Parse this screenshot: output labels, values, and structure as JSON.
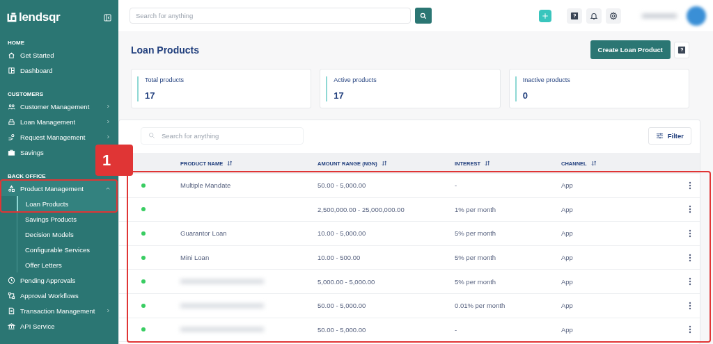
{
  "sidebar": {
    "logo": "lendsqr",
    "sections": [
      {
        "title": "HOME",
        "items": [
          {
            "label": "Get Started",
            "expandable": false,
            "expanded": false
          },
          {
            "label": "Dashboard",
            "expandable": false,
            "expanded": false
          }
        ]
      },
      {
        "title": "CUSTOMERS",
        "items": [
          {
            "label": "Customer Management",
            "expandable": true,
            "expanded": false
          },
          {
            "label": "Loan Management",
            "expandable": true,
            "expanded": false
          },
          {
            "label": "Request Management",
            "expandable": true,
            "expanded": false
          },
          {
            "label": "Savings",
            "expandable": false,
            "expanded": false
          }
        ]
      },
      {
        "title": "BACK OFFICE",
        "items": [
          {
            "label": "Product Management",
            "expandable": true,
            "expanded": true,
            "children": [
              {
                "label": "Loan Products",
                "selected": true
              },
              {
                "label": "Savings Products",
                "selected": false
              },
              {
                "label": "Decision Models",
                "selected": false
              },
              {
                "label": "Configurable Services",
                "selected": false
              },
              {
                "label": "Offer Letters",
                "selected": false
              }
            ]
          },
          {
            "label": "Pending Approvals",
            "expandable": false,
            "expanded": false
          },
          {
            "label": "Approval Workflows",
            "expandable": false,
            "expanded": false
          },
          {
            "label": "Transaction Management",
            "expandable": true,
            "expanded": false
          },
          {
            "label": "API Service",
            "expandable": false,
            "expanded": false
          }
        ]
      }
    ]
  },
  "topbar": {
    "search": {
      "placeholder": "Search for anything"
    }
  },
  "page": {
    "title": "Loan Products",
    "primary_button": "Create Loan Product"
  },
  "stats": [
    {
      "label": "Total products",
      "value": "17"
    },
    {
      "label": "Active products",
      "value": "17"
    },
    {
      "label": "Inactive products",
      "value": "0"
    }
  ],
  "table": {
    "search": {
      "placeholder": "Search for anything"
    },
    "filter_button": "Filter",
    "columns": [
      "PRODUCT NAME",
      "AMOUNT RANGE (NGN)",
      "INTEREST",
      "CHANNEL"
    ],
    "rows": [
      {
        "active": true,
        "name": "Multiple Mandate",
        "blurred": false,
        "amount_range": "50.00 - 5,000.00",
        "interest": "-",
        "channel": "App"
      },
      {
        "active": true,
        "blurred": false,
        "amount_range": "2,500,000.00 - 25,000,000.00",
        "interest": "1% per month",
        "channel": "App"
      },
      {
        "active": true,
        "name": "Guarantor Loan",
        "blurred": false,
        "amount_range": "10.00 - 5,000.00",
        "interest": "5% per month",
        "channel": "App"
      },
      {
        "active": true,
        "name": "Mini Loan",
        "blurred": false,
        "amount_range": "10.00 - 500.00",
        "interest": "5% per month",
        "channel": "App"
      },
      {
        "active": true,
        "blurred": true,
        "amount_range": "5,000.00 - 5,000.00",
        "interest": "5% per month",
        "channel": "App"
      },
      {
        "active": true,
        "blurred": true,
        "amount_range": "50.00 - 5,000.00",
        "interest": "0.01% per month",
        "channel": "App"
      },
      {
        "active": true,
        "blurred": true,
        "amount_range": "50.00 - 5,000.00",
        "interest": "-",
        "channel": "App"
      }
    ]
  },
  "annotation": {
    "callout": "1"
  }
}
